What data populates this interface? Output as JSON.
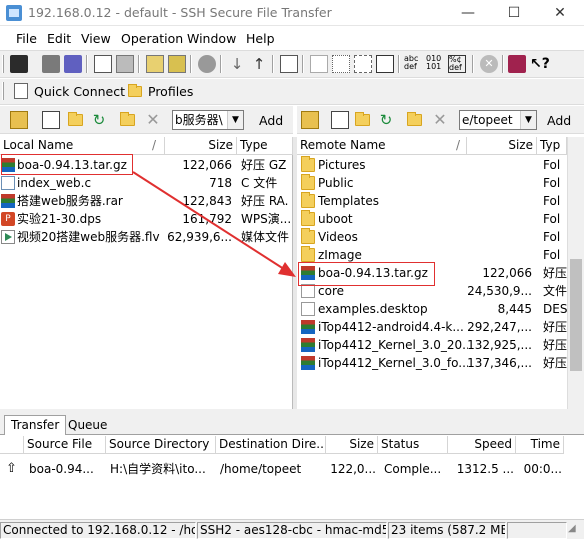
{
  "window": {
    "title": "192.168.0.12 - default - SSH Secure File Transfer",
    "minimize": "—",
    "maximize": "☐",
    "close": "✕"
  },
  "menu": [
    "File",
    "Edit",
    "View",
    "Operation",
    "Window",
    "Help"
  ],
  "toolbar2": {
    "quick_connect": "Quick Connect",
    "profiles": "Profiles"
  },
  "local": {
    "path": "b服务器\\",
    "add": "Add",
    "columns": [
      "Local Name",
      "Size",
      "Type"
    ],
    "files": [
      {
        "name": "boa-0.94.13.tar.gz",
        "size": "122,066",
        "type": "好压 GZ",
        "icon": "archive"
      },
      {
        "name": "index_web.c",
        "size": "718",
        "type": "C 文件",
        "icon": "text"
      },
      {
        "name": "搭建web服务器.rar",
        "size": "122,843",
        "type": "好压 RA.",
        "icon": "archive"
      },
      {
        "name": "实验21-30.dps",
        "size": "161,792",
        "type": "WPS演...",
        "icon": "ppt"
      },
      {
        "name": "视频20搭建web服务器.flv",
        "size": "62,939,6...",
        "type": "媒体文件",
        "icon": "video"
      }
    ]
  },
  "remote": {
    "path": "e/topeet",
    "add": "Add",
    "columns": [
      "Remote Name",
      "Size",
      "Typ"
    ],
    "files": [
      {
        "name": "Pictures",
        "size": "",
        "type": "Fol",
        "icon": "folder"
      },
      {
        "name": "Public",
        "size": "",
        "type": "Fol",
        "icon": "folder"
      },
      {
        "name": "Templates",
        "size": "",
        "type": "Fol",
        "icon": "folder"
      },
      {
        "name": "uboot",
        "size": "",
        "type": "Fol",
        "icon": "folder"
      },
      {
        "name": "Videos",
        "size": "",
        "type": "Fol",
        "icon": "folder"
      },
      {
        "name": "zImage",
        "size": "",
        "type": "Fol",
        "icon": "folder"
      },
      {
        "name": "boa-0.94.13.tar.gz",
        "size": "122,066",
        "type": "好压",
        "icon": "archive"
      },
      {
        "name": "core",
        "size": "24,530,9...",
        "type": "文件",
        "icon": "file"
      },
      {
        "name": "examples.desktop",
        "size": "8,445",
        "type": "DES",
        "icon": "desktop"
      },
      {
        "name": "iTop4412-android4.4-k...",
        "size": "292,247,...",
        "type": "好压",
        "icon": "archive"
      },
      {
        "name": "iTop4412_Kernel_3.0_20...",
        "size": "132,925,...",
        "type": "好压",
        "icon": "archive"
      },
      {
        "name": "iTop4412_Kernel_3.0_fo...",
        "size": "137,346,...",
        "type": "好压",
        "icon": "archive"
      }
    ]
  },
  "transfer": {
    "tabs": [
      "Transfer",
      "Queue"
    ],
    "columns": [
      "Source File",
      "Source Directory",
      "Destination Dire...",
      "Size",
      "Status",
      "Speed",
      "Time"
    ],
    "rows": [
      {
        "arrow": "⇧",
        "source_file": "boa-0.94...",
        "source_dir": "H:\\自学资料\\ito...",
        "dest_dir": "/home/topeet",
        "size": "122,0...",
        "status": "Comple...",
        "speed": "1312.5 ...",
        "time": "00:0..."
      }
    ]
  },
  "status": {
    "connection": "Connected to 192.168.0.12 - /hon",
    "cipher": "SSH2 - aes128-cbc - hmac-md5",
    "items": "23 items (587.2 MB"
  },
  "colors": {
    "annotation": "#e03030",
    "toolbar_bg": "#f0f0f0"
  }
}
